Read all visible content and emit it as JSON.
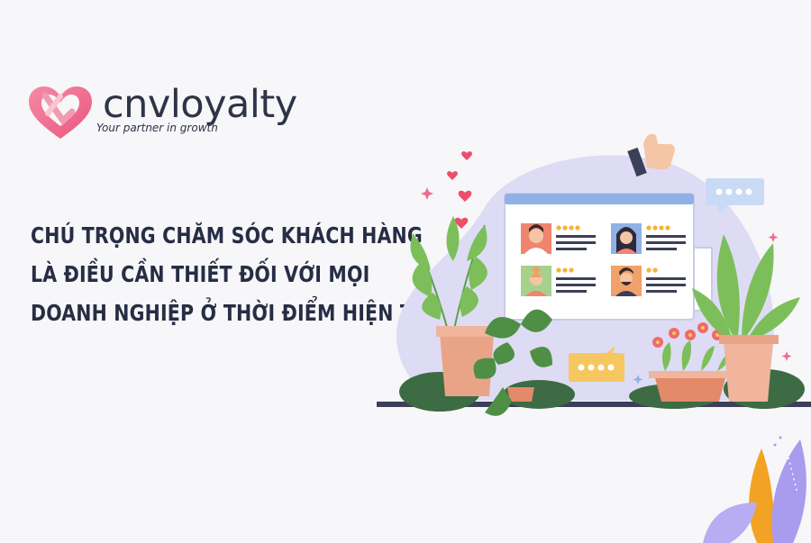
{
  "brand": {
    "name": "cnvloyalty",
    "tagline": "Your partner in growth",
    "colors": {
      "heart": "#f06a8e",
      "heart_light": "#f7a9bd",
      "text": "#2d3447"
    }
  },
  "headline": {
    "lines": [
      "CHÚ TRỌNG CHĂM SÓC KHÁCH HÀNG",
      "LÀ ĐIỀU CẦN THIẾT ĐỐI VỚI MỌI",
      "DOANH NGHIỆP Ở THỜI ĐIỂM HIỆN TẠI"
    ],
    "color": "#262d44"
  },
  "illustration": {
    "review_cards": [
      {
        "avatar": "man-short-hair",
        "stars": 4
      },
      {
        "avatar": "woman-dark-hair",
        "stars": 4
      },
      {
        "avatar": "woman-bun",
        "stars": 3
      },
      {
        "avatar": "man-beard",
        "stars": 2
      }
    ],
    "icons": [
      "thumbs-up-icon",
      "heart-icon",
      "chat-bubble-icon",
      "plant-icon",
      "flower-pot-icon"
    ],
    "colors": {
      "blob": "#dcdcf5",
      "window": "#ffffff",
      "window_bar": "#8fb0e6",
      "leaf": "#7cbf5a",
      "dark_leaf": "#3e6e3a",
      "pot": "#e9a487",
      "star": "#f5b335"
    }
  }
}
